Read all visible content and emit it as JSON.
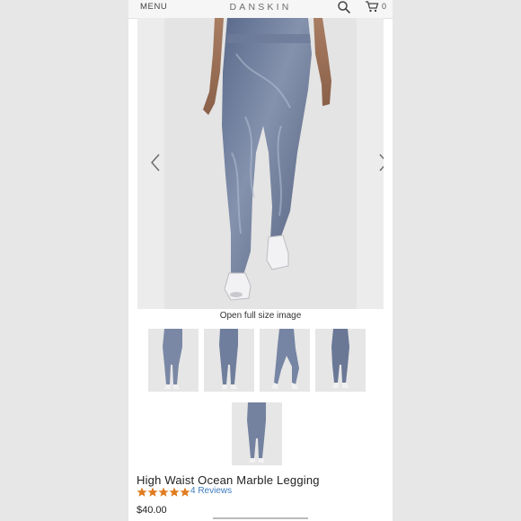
{
  "header": {
    "menu_label": "MENU",
    "brand": "DANSKIN",
    "cart_count": "0",
    "search_icon": "search-icon",
    "cart_icon": "cart-icon"
  },
  "gallery": {
    "prev_icon": "chevron-left-icon",
    "next_icon": "chevron-right-icon",
    "open_full_label": "Open full size image",
    "thumbnail_count": 5
  },
  "product": {
    "title": "High Waist Ocean Marble Legging",
    "rating": 5,
    "reviews_label": "4 Reviews",
    "price": "$40.00"
  },
  "colors": {
    "legging": "#6c7a98",
    "star": "#e07b20",
    "review_link": "#3e7bbf"
  }
}
